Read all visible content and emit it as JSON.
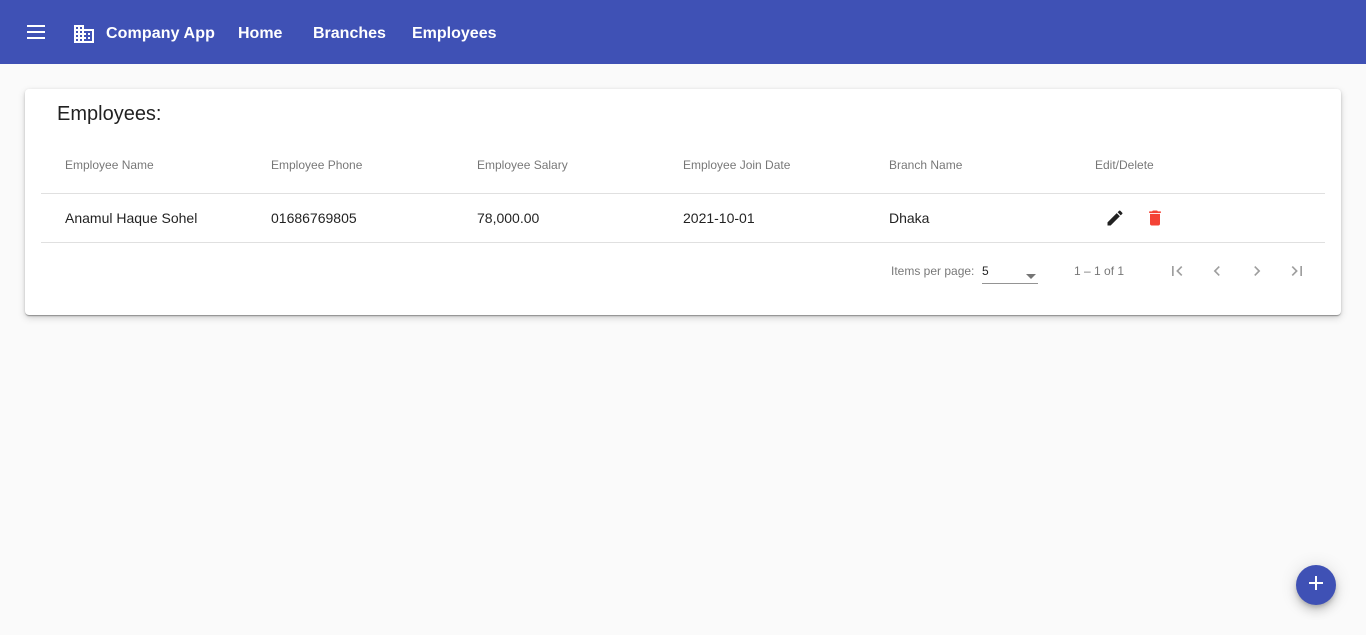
{
  "toolbar": {
    "menu_icon": "menu-icon",
    "brand_icon": "building-icon",
    "title": "Company App",
    "nav": [
      "Home",
      "Branches",
      "Employees"
    ],
    "color": "#3f51b5"
  },
  "main": {
    "card_title": "Employees:",
    "columns": [
      "Employee Name",
      "Employee Phone",
      "Employee Salary",
      "Employee Join Date",
      "Branch Name",
      "Edit/Delete"
    ],
    "rows": [
      {
        "name": "Anamul Haque Sohel",
        "phone": "01686769805",
        "salary": "78,000.00",
        "join_date": "2021-10-01",
        "branch": "Dhaka",
        "edit_icon": "pencil-icon",
        "delete_icon": "trash-icon",
        "delete_color": "#f44336"
      }
    ],
    "paginator": {
      "items_per_page_label": "Items per page:",
      "page_size": "5",
      "range": "1 – 1 of 1"
    }
  },
  "fab": {
    "icon": "plus-icon",
    "label": "+"
  }
}
